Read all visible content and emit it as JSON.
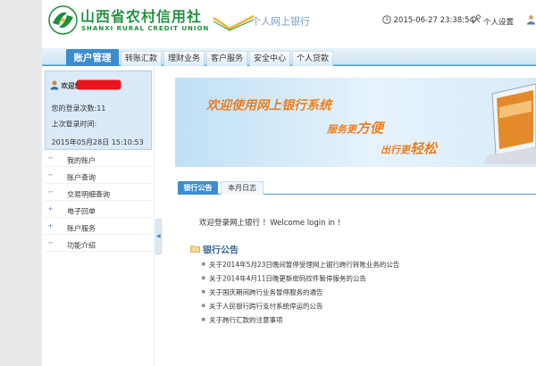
{
  "header": {
    "bank_name_cn": "山西省农村信用社",
    "bank_name_en": "SHANXI RURAL CREDIT UNION",
    "banking_title": "个人网上银行",
    "datetime": "2015-06-27 23:38:54",
    "settings_label": "个人设置",
    "brand_color": "#1c8f3a",
    "accent_color": "#3c8dd0"
  },
  "nav": {
    "tabs": [
      {
        "label": "账户管理",
        "active": true
      },
      {
        "label": "转账汇款"
      },
      {
        "label": "理财业务"
      },
      {
        "label": "客户服务"
      },
      {
        "label": "安全中心"
      },
      {
        "label": "个人贷款"
      }
    ]
  },
  "user_panel": {
    "welcome": "欢迎您",
    "login_count": "您的登录次数:11",
    "last_login_label": "上次登录时间:",
    "last_login_time": "2015年05月28日  15:10:53"
  },
  "sidebar_menu": [
    {
      "sign": "−",
      "label": "我的账户"
    },
    {
      "sign": "−",
      "label": "账户查询"
    },
    {
      "sign": "−",
      "label": "交易明细查询"
    },
    {
      "sign": "+",
      "label": "电子回单"
    },
    {
      "sign": "+",
      "label": "账户服务"
    },
    {
      "sign": "−",
      "label": "功能介绍"
    }
  ],
  "banner": {
    "line1": "欢迎使用网上银行系统",
    "line2_prefix": "服务更",
    "line2_emph": "方便",
    "line3_prefix": "出行更",
    "line3_emph": "轻松"
  },
  "content_tabs": [
    {
      "label": "银行公告",
      "active": true
    },
    {
      "label": "本月日志"
    }
  ],
  "welcome_message": "欢迎登录网上银行 ！Welcome login in !",
  "announcements": {
    "title": "银行公告",
    "items": [
      "关于2014年5月23日晚间暂停受理网上银行跨行转账业务的公告",
      "关于2014年4月11日晚更新密码控件暂停服务的公告",
      "关于国庆期间跨行业务暂停服务的通告",
      "关于人民银行跨行支付系统停运的公告",
      "关于跨行汇款的注意事项"
    ]
  }
}
